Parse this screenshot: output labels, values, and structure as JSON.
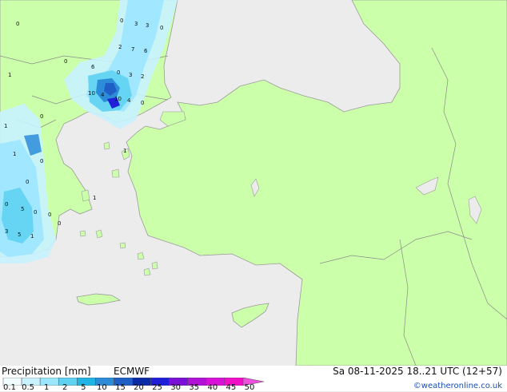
{
  "map": {
    "region": "Aegean Sea and Turkey",
    "colors": {
      "sea": "#ececec",
      "land": "#ccffaa",
      "coast": "#9a9a9a",
      "border": "#8a8a8a"
    },
    "value_labels": [
      "0",
      "3",
      "3",
      "0",
      "2",
      "7",
      "6",
      "0",
      "0",
      "6",
      "0",
      "3",
      "2",
      "10",
      "4",
      "10",
      "4",
      "0",
      "1",
      "1",
      "0",
      "1",
      "0",
      "1",
      "0",
      "0",
      "0",
      "5",
      "0",
      "0",
      "3",
      "5",
      "1",
      "1"
    ]
  },
  "legend": {
    "title": "Precipitation [mm]",
    "model": "ECMWF",
    "ticks": [
      "0.1",
      "0.5",
      "1",
      "2",
      "5",
      "10",
      "15",
      "20",
      "25",
      "30",
      "35",
      "40",
      "45",
      "50"
    ],
    "colors": [
      "#f0fcff",
      "#c8f2ff",
      "#9be6ff",
      "#5fd2f2",
      "#1fb4e4",
      "#2c8cd8",
      "#1f5ec4",
      "#0a2aa6",
      "#2020d8",
      "#7a10d8",
      "#b010d8",
      "#d810d8",
      "#f010c8",
      "#f050e0"
    ]
  },
  "datetime": "Sa 08-11-2025 18..21 UTC (12+57)",
  "credit": "©weatheronline.co.uk"
}
